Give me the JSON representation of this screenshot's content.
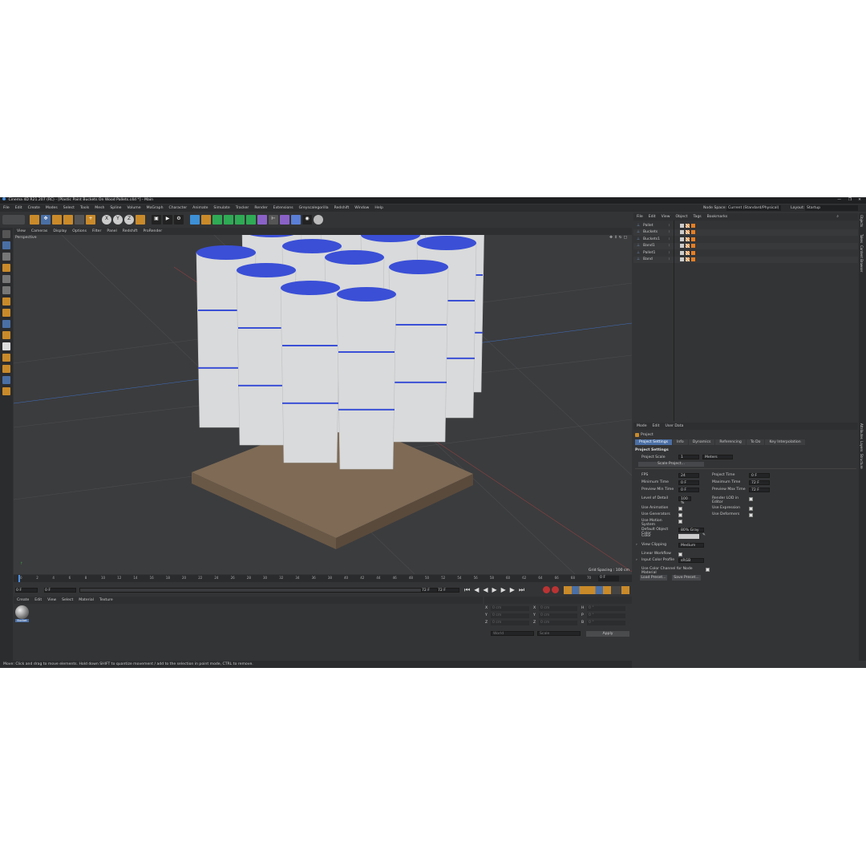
{
  "window": {
    "title": "Cinema 4D R21.207 (RC) - [Plastic Paint Buckets On Wood Pallets.c4d *] - Main"
  },
  "menu": [
    "File",
    "Edit",
    "Create",
    "Modes",
    "Select",
    "Tools",
    "Mesh",
    "Spline",
    "Volume",
    "MoGraph",
    "Character",
    "Animate",
    "Simulate",
    "Tracker",
    "Render",
    "Extensions",
    "Greyscalegorilla",
    "Redshift",
    "Window",
    "Help"
  ],
  "nodespace": {
    "label": "Node Space:",
    "value": "Current (Standard/Physical)"
  },
  "layout": {
    "label": "Layout:",
    "value": "Startup"
  },
  "viewport": {
    "menu": [
      "View",
      "Cameras",
      "Display",
      "Options",
      "Filter",
      "Panel",
      "Redshift",
      "ProRender"
    ],
    "name": "Perspective",
    "camera": "Default Camera",
    "grid": "Grid Spacing : 100 cm"
  },
  "objects": {
    "menu": [
      "File",
      "Edit",
      "View",
      "Object",
      "Tags",
      "Bookmarks"
    ],
    "items": [
      "Pallet",
      "Buckets",
      "Buckets1",
      "Band1",
      "Pallet1",
      "Band"
    ]
  },
  "timeline": {
    "ticks": [
      "0",
      "2",
      "4",
      "6",
      "8",
      "10",
      "12",
      "14",
      "16",
      "18",
      "20",
      "22",
      "24",
      "26",
      "28",
      "30",
      "32",
      "34",
      "36",
      "38",
      "40",
      "42",
      "44",
      "46",
      "48",
      "50",
      "52",
      "54",
      "56",
      "58",
      "60",
      "62",
      "64",
      "66",
      "68",
      "70",
      "72"
    ],
    "end_frame": "0 F",
    "start": "0 F",
    "start2": "0 F",
    "end": "72 F",
    "end2": "72 F"
  },
  "materials": {
    "menu": [
      "Create",
      "Edit",
      "View",
      "Select",
      "Material",
      "Texture"
    ],
    "mat_name": "Bucket"
  },
  "coords": {
    "rows": [
      [
        "X",
        "0 cm",
        "X",
        "0 cm",
        "H",
        "0 °"
      ],
      [
        "Y",
        "0 cm",
        "Y",
        "0 cm",
        "P",
        "0 °"
      ],
      [
        "Z",
        "0 cm",
        "Z",
        "0 cm",
        "B",
        "0 °"
      ]
    ],
    "mode1": "World",
    "mode2": "Scale",
    "apply": "Apply"
  },
  "attributes": {
    "menu": [
      "Mode",
      "Edit",
      "User Data"
    ],
    "object": "Project",
    "tabs": [
      "Project Settings",
      "Info",
      "Dynamics",
      "Referencing",
      "To Do",
      "Key Interpolation"
    ],
    "section": "Project Settings",
    "scale_label": "Project Scale",
    "scale_value": "1",
    "scale_unit": "Meters",
    "scale_btn": "Scale Project...",
    "fps_label": "FPS",
    "fps": "24",
    "ptime_label": "Project Time",
    "ptime": "0 F",
    "mintime_label": "Minimum Time",
    "mintime": "0 F",
    "maxtime_label": "Maximum Time",
    "maxtime": "72 F",
    "pmin_label": "Preview Min Time",
    "pmin": "0 F",
    "pmax_label": "Preview Max Time",
    "pmax": "72 F",
    "lod_label": "Level of Detail",
    "lod": "100 %",
    "rlod_label": "Render LOD in Editor",
    "anim_label": "Use Animation",
    "expr_label": "Use Expression",
    "gen_label": "Use Generators",
    "def_label": "Use Deformers",
    "motion_label": "Use Motion System",
    "objcolor_label": "Default Object Color",
    "objcolor": "80% Gray",
    "color_label": "Color",
    "clip_label": "View Clipping",
    "clip": "Medium",
    "linear_label": "Linear Workflow",
    "profile_label": "Input Color Profile",
    "profile": "sRGB",
    "channel_label": "Use Color Channel for Node Material",
    "load": "Load Preset...",
    "save": "Save Preset..."
  },
  "status": "Move: Click and drag to move elements. Hold down SHIFT to quantize movement / add to the selection in point mode, CTRL to remove.",
  "right_tabs": [
    "Objects",
    "Takes",
    "Content Browser",
    "Attributes",
    "Layers",
    "Structure"
  ],
  "colors": {
    "bg": "#333436",
    "accent": "#4a6fa5",
    "bucket_lid": "#3a4fd6",
    "bucket_body": "#d9dadb",
    "wood": "#8a7560"
  }
}
